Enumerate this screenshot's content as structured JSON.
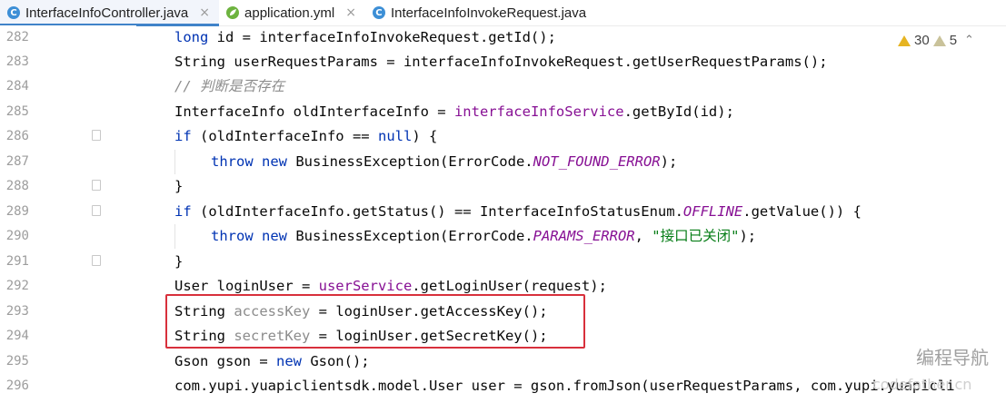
{
  "tabs": [
    {
      "label": "InterfaceInfoController.java",
      "icon": "C",
      "type": "java-class",
      "active": true
    },
    {
      "label": "application.yml",
      "icon": "yml",
      "type": "yml",
      "active": false
    },
    {
      "label": "InterfaceInfoInvokeRequest.java",
      "icon": "C",
      "type": "java-class",
      "active": false
    }
  ],
  "close_glyph": "×",
  "inspections": {
    "warnings": "30",
    "weak_warnings": "5"
  },
  "line_numbers": [
    "282",
    "283",
    "284",
    "285",
    "286",
    "287",
    "288",
    "289",
    "290",
    "291",
    "292",
    "293",
    "294",
    "295",
    "296"
  ],
  "code": {
    "l282": {
      "a": "long",
      "b": " id = interfaceInfoInvokeRequest.getId();"
    },
    "l283": {
      "a": "String userRequestParams = interfaceInfoInvokeRequest.getUserRequestParams();"
    },
    "l284": {
      "a": "// 判断是否存在"
    },
    "l285": {
      "a": "InterfaceInfo oldInterfaceInfo = ",
      "b": "interfaceInfoService",
      "c": ".getById(id);"
    },
    "l286": {
      "a": "if",
      "b": " (oldInterfaceInfo == ",
      "c": "null",
      "d": ") {"
    },
    "l287": {
      "a": "throw",
      "b": " ",
      "c": "new",
      "d": " BusinessException(ErrorCode.",
      "e": "NOT_FOUND_ERROR",
      "f": ");"
    },
    "l288": {
      "a": "}"
    },
    "l289": {
      "a": "if",
      "b": " (oldInterfaceInfo.getStatus() == InterfaceInfoStatusEnum.",
      "c": "OFFLINE",
      "d": ".getValue()) {"
    },
    "l290": {
      "a": "throw",
      "b": " ",
      "c": "new",
      "d": " BusinessException(ErrorCode.",
      "e": "PARAMS_ERROR",
      "f": ", ",
      "g": "\"接口已关闭\"",
      "h": ");"
    },
    "l291": {
      "a": "}"
    },
    "l292": {
      "a": "User loginUser = ",
      "b": "userService",
      "c": ".getLoginUser(request);"
    },
    "l293": {
      "a": "String ",
      "b": "accessKey",
      "c": " = loginUser.getAccessKey();"
    },
    "l294": {
      "a": "String ",
      "b": "secretKey",
      "c": " = loginUser.getSecretKey();"
    },
    "l295": {
      "a": "Gson gson = ",
      "b": "new",
      "c": " Gson();"
    },
    "l296": {
      "a": "com.yupi.yuapiclientsdk.model.User user = gson.fromJson(userRequestParams, com.yupi.yuapicli"
    }
  },
  "watermark": {
    "text": "编程导航",
    "site": "codefather.cn"
  },
  "colors": {
    "keyword": "#0033b3",
    "field": "#871094",
    "string": "#067d17",
    "comment": "#8c8c8c",
    "highlight_box": "#d8303c",
    "tab_active_underline": "#4083c9"
  }
}
